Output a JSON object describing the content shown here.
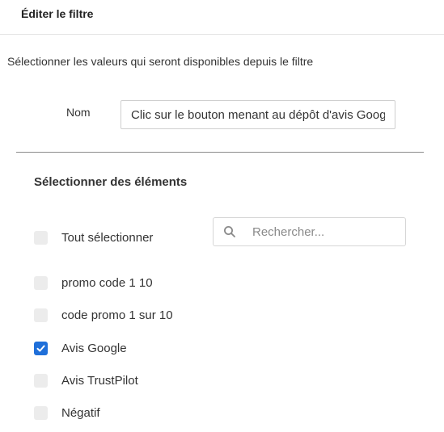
{
  "header": {
    "title": "Éditer le filtre"
  },
  "description": "Sélectionner les valeurs qui seront disponibles depuis le filtre",
  "name_field": {
    "label": "Nom",
    "value": "Clic sur le bouton menant au dépôt d'avis Google"
  },
  "elements": {
    "title": "Sélectionner des éléments",
    "select_all": {
      "label": "Tout sélectionner",
      "checked": false
    },
    "search": {
      "placeholder": "Rechercher...",
      "icon": "search-icon"
    },
    "items": [
      {
        "label": "promo code 1 10",
        "checked": false
      },
      {
        "label": "code promo 1 sur 10",
        "checked": false
      },
      {
        "label": "Avis Google",
        "checked": true
      },
      {
        "label": "Avis TrustPilot",
        "checked": false
      },
      {
        "label": "Négatif",
        "checked": false
      }
    ]
  },
  "colors": {
    "accent": "#1f6fd9",
    "checkbox_unchecked": "#ececec"
  }
}
